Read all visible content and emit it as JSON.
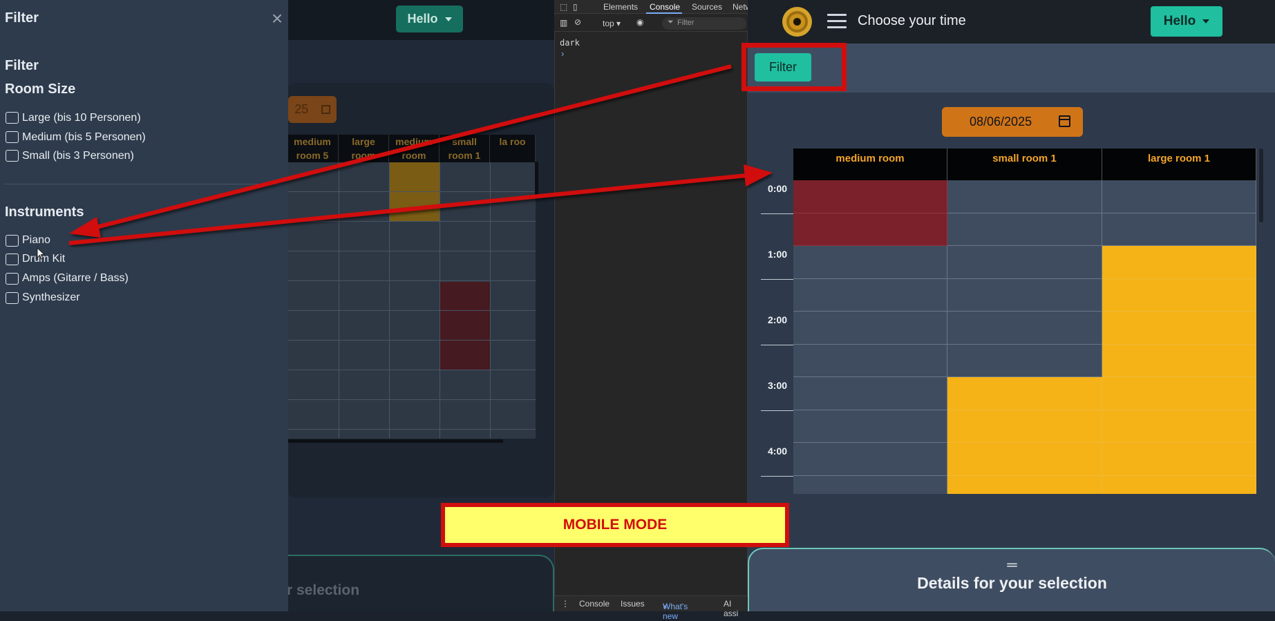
{
  "background_app": {
    "hello_label": "Hello",
    "date_fragment": "25",
    "table_headers": [
      "medium room 5",
      "large room",
      "medium room",
      "small room 1",
      "la roo"
    ],
    "details_fragment": "r selection"
  },
  "devtools": {
    "tabs": [
      "Elements",
      "Console",
      "Sources",
      "Netw"
    ],
    "context": "top",
    "filter_placeholder": "Filter",
    "console_output": "dark",
    "prompt": "›",
    "bottom_tabs": [
      "Console",
      "Issues",
      "What's new",
      "AI assi"
    ],
    "close_glyph": "×"
  },
  "app": {
    "title": "Choose your time",
    "user_label": "Hello",
    "filter_button": "Filter",
    "date": "08/06/2025",
    "rooms": [
      "medium room",
      "small room 1",
      "large room 1"
    ],
    "times": [
      "0:00",
      "1:00",
      "2:00",
      "3:00",
      "4:00"
    ],
    "slot_states": [
      [
        "booked",
        "free",
        "free"
      ],
      [
        "booked",
        "free",
        "free"
      ],
      [
        "free",
        "free",
        "selected"
      ],
      [
        "free",
        "free",
        "selected"
      ],
      [
        "free",
        "free",
        "selected"
      ],
      [
        "free",
        "free",
        "selected"
      ],
      [
        "free",
        "selected",
        "selected"
      ],
      [
        "free",
        "selected",
        "selected"
      ],
      [
        "free",
        "selected",
        "selected"
      ],
      [
        "free",
        "selected",
        "selected"
      ]
    ],
    "details_handle": "═",
    "details_title": "Details for your selection"
  },
  "drawer": {
    "header": "Filter",
    "close_glyph": "×",
    "section_title": "Filter",
    "room_size_title": "Room Size",
    "room_sizes": [
      "Large (bis 10 Personen)",
      "Medium (bis 5 Personen)",
      "Small (bis 3 Personen)"
    ],
    "instruments_title": "Instruments",
    "instruments": [
      "Piano",
      "Drum Kit",
      "Amps (Gitarre / Bass)",
      "Synthesizer"
    ]
  },
  "annotation": {
    "banner": "MOBILE MODE"
  },
  "colors": {
    "accent_teal": "#1fbf9f",
    "date_orange": "#d07418",
    "booked_red": "#7b212b",
    "selected_yellow": "#f5b317",
    "annotation_red": "#d10e0e",
    "banner_yellow": "#ffff6b"
  }
}
